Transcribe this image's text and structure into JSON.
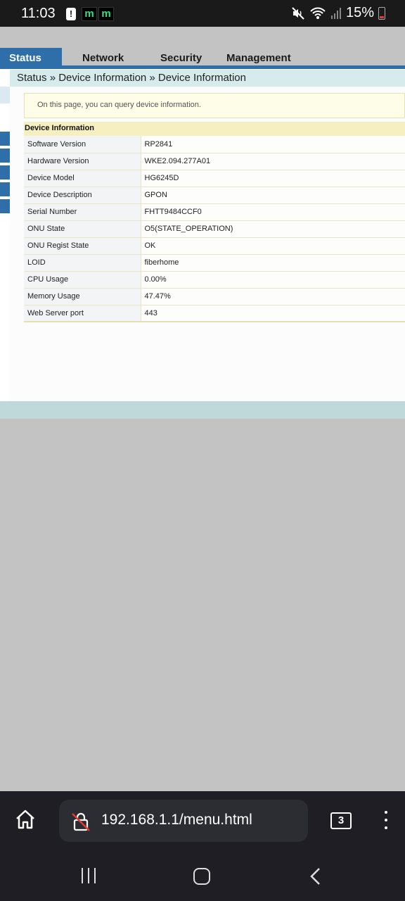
{
  "status_bar": {
    "time": "11:03",
    "notification_icons": [
      "alert-icon",
      "m-app-icon",
      "m-app-icon"
    ],
    "app_icon_letter": "m",
    "alert_glyph": "!",
    "right_icons": [
      "mute-icon",
      "wifi-icon",
      "signal-icon"
    ],
    "battery_percent": "15%"
  },
  "router_ui": {
    "nav_tabs": [
      {
        "label": "Status",
        "active": true
      },
      {
        "label": "Network",
        "active": false
      },
      {
        "label": "Security",
        "active": false
      },
      {
        "label": "Management",
        "active": false
      }
    ],
    "breadcrumb": "Status » Device Information » Device Information",
    "notice": "On this page, you can query device information.",
    "section_title": "Device Information",
    "rows": [
      {
        "label": "Software Version",
        "value": "RP2841"
      },
      {
        "label": "Hardware Version",
        "value": "WKE2.094.277A01"
      },
      {
        "label": "Device Model",
        "value": "HG6245D"
      },
      {
        "label": "Device Description",
        "value": "GPON"
      },
      {
        "label": "Serial Number",
        "value": "FHTT9484CCF0"
      },
      {
        "label": "ONU State",
        "value": "O5(STATE_OPERATION)"
      },
      {
        "label": "ONU Regist State",
        "value": "OK"
      },
      {
        "label": "LOID",
        "value": "fiberhome"
      },
      {
        "label": "CPU Usage",
        "value": "0.00%"
      },
      {
        "label": "Memory Usage",
        "value": "47.47%"
      },
      {
        "label": "Web Server port",
        "value": "443"
      }
    ],
    "colors": {
      "accent": "#2e6faa",
      "breadcrumb_bg": "#d6ebec",
      "section_bg": "#f6f0c0"
    }
  },
  "browser": {
    "url": "192.168.1.1/menu.html",
    "tab_count": "3"
  }
}
